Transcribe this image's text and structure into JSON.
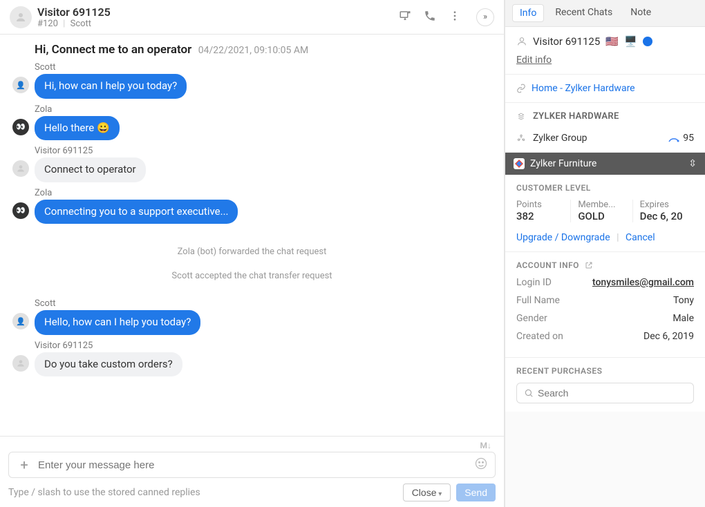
{
  "header": {
    "visitor_name": "Visitor 691125",
    "chat_id": "#120",
    "agent_name": "Scott"
  },
  "conversation": {
    "topic": "Hi, Connect me to an operator",
    "timestamp": "04/22/2021, 09:10:05 AM",
    "messages": [
      {
        "sender": "Scott",
        "role": "agent",
        "text": "Hi, how can I help you today?",
        "avatar": "agent"
      },
      {
        "sender": "Zola",
        "role": "agent",
        "text": "Hello there 😀",
        "avatar": "bot"
      },
      {
        "sender": "Visitor 691125",
        "role": "visitor",
        "text": "Connect to operator",
        "avatar": "visitor"
      },
      {
        "sender": "Zola",
        "role": "agent",
        "text": "Connecting you to a support executive...",
        "avatar": "bot"
      }
    ],
    "system_events": [
      "Zola (bot) forwarded the chat request",
      "Scott accepted the chat transfer request"
    ],
    "messages_after": [
      {
        "sender": "Scott",
        "role": "agent",
        "text": "Hello, how can I help you today?",
        "avatar": "agent"
      },
      {
        "sender": "Visitor 691125",
        "role": "visitor",
        "text": "Do you take custom orders?",
        "avatar": "visitor"
      }
    ]
  },
  "composer": {
    "markdown_hint": "M↓",
    "placeholder": "Enter your message here",
    "canned_hint": "Type / slash to use the stored canned replies",
    "close_label": "Close",
    "send_label": "Send"
  },
  "sidebar": {
    "tabs": {
      "info": "Info",
      "recent": "Recent Chats",
      "note": "Note"
    },
    "visitor_name": "Visitor 691125",
    "edit_info": "Edit info",
    "page_link": "Home - Zylker Hardware",
    "org_name": "ZYLKER HARDWARE",
    "group_name": "Zylker Group",
    "score": "95",
    "integration_name": "Zylker Furniture",
    "customer_level": {
      "section_label": "CUSTOMER LEVEL",
      "points_label": "Points",
      "points_value": "382",
      "membership_label": "Membe...",
      "membership_value": "GOLD",
      "expires_label": "Expires",
      "expires_value": "Dec 6, 20",
      "upgrade_label": "Upgrade / Downgrade",
      "cancel_label": "Cancel"
    },
    "account_info": {
      "section_label": "ACCOUNT INFO",
      "login_id_label": "Login ID",
      "login_id_value": "tonysmiles@gmail.com",
      "fullname_label": "Full Name",
      "fullname_value": "Tony",
      "gender_label": "Gender",
      "gender_value": "Male",
      "created_label": "Created on",
      "created_value": "Dec 6, 2019"
    },
    "recent_purchases": {
      "section_label": "RECENT PURCHASES",
      "search_placeholder": "Search"
    }
  }
}
